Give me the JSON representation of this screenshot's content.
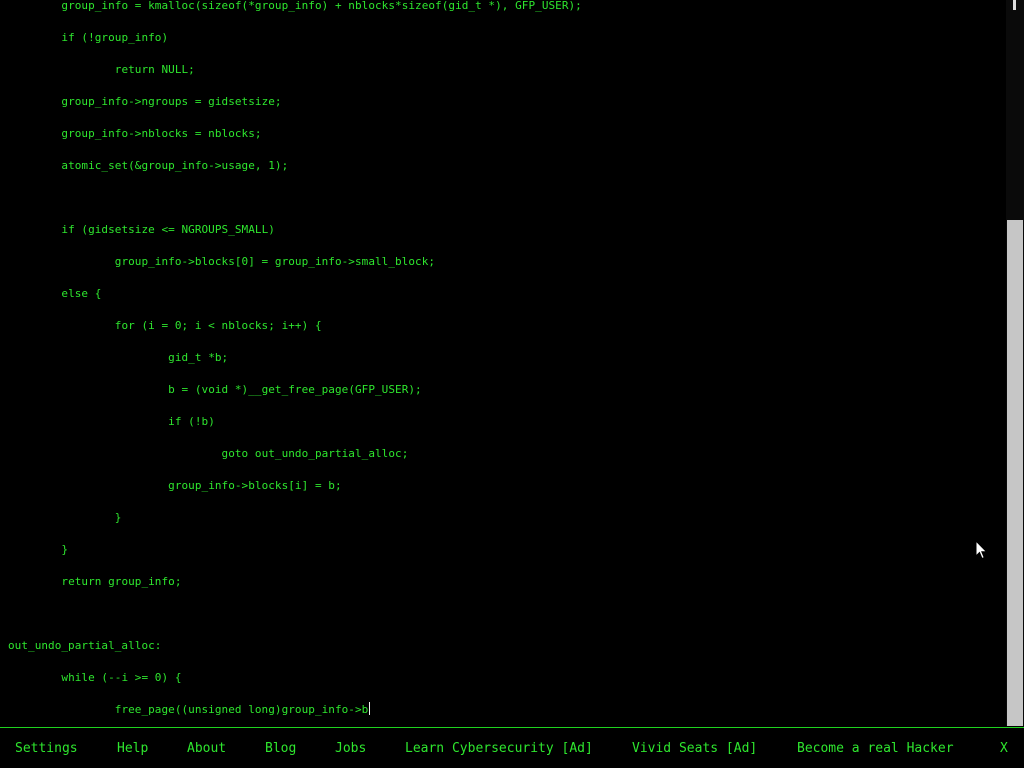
{
  "code_lines": [
    "\tgroup_info = kmalloc(sizeof(*group_info) + nblocks*sizeof(gid_t *), GFP_USER);",
    "\tif (!group_info)",
    "\t\treturn NULL;",
    "\tgroup_info->ngroups = gidsetsize;",
    "\tgroup_info->nblocks = nblocks;",
    "\tatomic_set(&group_info->usage, 1);",
    "",
    "\tif (gidsetsize <= NGROUPS_SMALL)",
    "\t\tgroup_info->blocks[0] = group_info->small_block;",
    "\telse {",
    "\t\tfor (i = 0; i < nblocks; i++) {",
    "\t\t\tgid_t *b;",
    "\t\t\tb = (void *)__get_free_page(GFP_USER);",
    "\t\t\tif (!b)",
    "\t\t\t\tgoto out_undo_partial_alloc;",
    "\t\t\tgroup_info->blocks[i] = b;",
    "\t\t}",
    "\t}",
    "\treturn group_info;",
    "",
    "out_undo_partial_alloc:",
    "\twhile (--i >= 0) {",
    "\t\tfree_page((unsigned long)group_info->b"
  ],
  "menu": {
    "settings": "Settings",
    "help": "Help",
    "about": "About",
    "blog": "Blog",
    "jobs": "Jobs",
    "learn_cyber": "Learn Cybersecurity [Ad]",
    "vivid_seats": "Vivid Seats [Ad]",
    "become_hacker": "Become a real Hacker",
    "close": "X"
  },
  "colors": {
    "text_green": "#2ee62e",
    "background": "#000000",
    "scrollbar_thumb": "#c6c6c6"
  },
  "icons": {
    "mouse_pointer": "arrow-cursor-icon"
  }
}
